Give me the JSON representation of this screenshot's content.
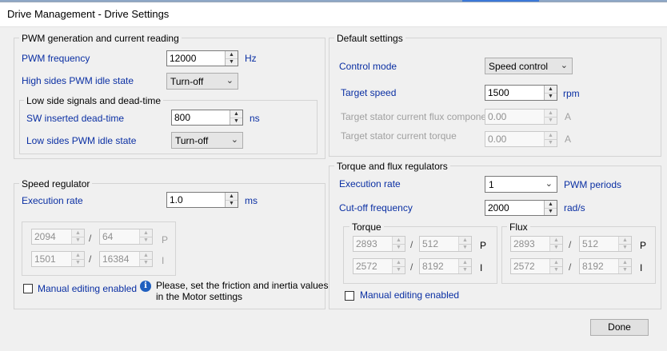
{
  "window": {
    "title": "Drive Management - Drive Settings"
  },
  "pwm": {
    "title": "PWM generation and current reading",
    "frequency_label": "PWM frequency",
    "frequency_value": "12000",
    "frequency_unit": "Hz",
    "high_idle_label": "High sides PWM idle state",
    "high_idle_value": "Turn-off",
    "low_group_title": "Low side signals and dead-time",
    "dead_time_label": "SW inserted dead-time",
    "dead_time_value": "800",
    "dead_time_unit": "ns",
    "low_idle_label": "Low sides PWM idle state",
    "low_idle_value": "Turn-off"
  },
  "defaults": {
    "title": "Default settings",
    "control_mode_label": "Control mode",
    "control_mode_value": "Speed control",
    "target_speed_label": "Target speed",
    "target_speed_value": "1500",
    "target_speed_unit": "rpm",
    "flux_label": "Target stator current flux component",
    "flux_value": "0.00",
    "flux_unit": "A",
    "torque_label": "Target stator current torque",
    "torque_value": "0.00",
    "torque_unit": "A"
  },
  "speed": {
    "title": "Speed regulator",
    "exec_label": "Execution rate",
    "exec_value": "1.0",
    "exec_unit": "ms",
    "p_num": "2094",
    "p_den": "64",
    "p_label": "P",
    "i_num": "1501",
    "i_den": "16384",
    "i_label": "I",
    "slash": "/",
    "manual_label": "Manual editing enabled",
    "info_text_1": "Please, set the friction and inertia values",
    "info_text_2": "in the Motor settings"
  },
  "regulators": {
    "title": "Torque and flux regulators",
    "exec_label": "Execution rate",
    "exec_value": "1",
    "exec_unit": "PWM periods",
    "cutoff_label": "Cut-off frequency",
    "cutoff_value": "2000",
    "cutoff_unit": "rad/s",
    "torque_title": "Torque",
    "torque_p_num": "2893",
    "torque_p_den": "512",
    "torque_i_num": "2572",
    "torque_i_den": "8192",
    "flux_title": "Flux",
    "flux_p_num": "2893",
    "flux_p_den": "512",
    "flux_i_num": "2572",
    "flux_i_den": "8192",
    "p_label": "P",
    "i_label": "I",
    "slash": "/",
    "manual_label": "Manual editing enabled"
  },
  "footer": {
    "done_label": "Done"
  },
  "icons": {
    "spin_up": "▲",
    "spin_down": "▼",
    "combo_arrow": "⌄",
    "info": "i"
  }
}
